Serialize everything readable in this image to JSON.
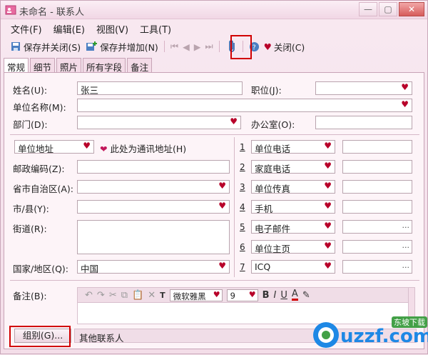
{
  "window": {
    "title": "未命名 - 联系人"
  },
  "menu": [
    "文件(F)",
    "编辑(E)",
    "视图(V)",
    "工具(T)"
  ],
  "toolbar": {
    "save_close": "保存并关闭(S)",
    "save_new": "保存并增加(N)",
    "close": "关闭(C)"
  },
  "tabs": [
    "常规",
    "细节",
    "照片",
    "所有字段",
    "备注"
  ],
  "general": {
    "name_label": "姓名(U):",
    "name_value": "张三",
    "position_label": "职位(J):",
    "position_value": "",
    "company_label": "单位名称(M):",
    "company_value": "",
    "dept_label": "部门(D):",
    "dept_value": "",
    "office_label": "办公室(O):",
    "office_value": ""
  },
  "address": {
    "type_value": "单位地址",
    "mailing_label": "此处为通讯地址(H)",
    "postal_label": "邮政编码(Z):",
    "postal_value": "",
    "province_label": "省市自治区(A):",
    "province_value": "",
    "city_label": "市/县(Y):",
    "city_value": "",
    "street_label": "街道(R):",
    "street_value": "",
    "country_label": "国家/地区(Q):",
    "country_value": "中国"
  },
  "phones": [
    {
      "num": "1",
      "type": "单位电话",
      "value": ""
    },
    {
      "num": "2",
      "type": "家庭电话",
      "value": ""
    },
    {
      "num": "3",
      "type": "单位传真",
      "value": ""
    },
    {
      "num": "4",
      "type": "手机",
      "value": ""
    },
    {
      "num": "5",
      "type": "电子邮件",
      "value": "",
      "ellipsis": "..."
    },
    {
      "num": "6",
      "type": "单位主页",
      "value": "",
      "ellipsis": "..."
    },
    {
      "num": "7",
      "type": "ICQ",
      "value": "",
      "ellipsis": "..."
    }
  ],
  "notes": {
    "label": "备注(B):",
    "font": "微软雅黑",
    "size": "9"
  },
  "group": {
    "button": "组别(G)...",
    "value": "其他联系人"
  },
  "watermark": {
    "text": "uzzf.com",
    "badge": "东坡下载"
  },
  "colors": {
    "accent": "#d10000",
    "heart": "#b8002a",
    "pink_bg": "#f6e6ee"
  }
}
